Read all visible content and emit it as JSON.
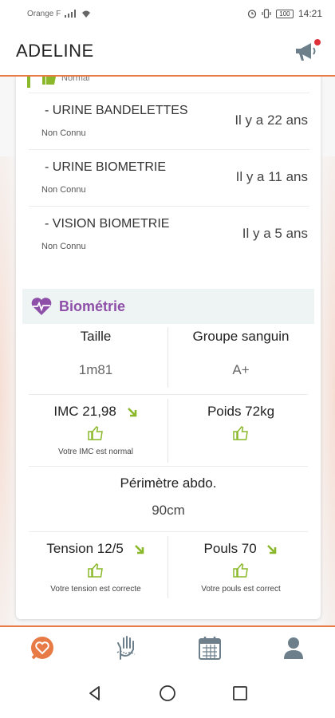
{
  "status_bar": {
    "carrier": "Orange F",
    "time": "14:21",
    "battery": "100"
  },
  "header": {
    "title": "ADELINE"
  },
  "partial_item": {
    "status": "Normal"
  },
  "exams": [
    {
      "name": "- URINE BANDELETTES",
      "status": "Non Connu",
      "when": "Il y a 22 ans"
    },
    {
      "name": "- URINE BIOMETRIE",
      "status": "Non Connu",
      "when": "Il y a 11 ans"
    },
    {
      "name": "- VISION BIOMETRIE",
      "status": "Non Connu",
      "when": "Il y a 5 ans"
    }
  ],
  "biometrie": {
    "title": "Biométrie",
    "taille_label": "Taille",
    "taille_value": "1m81",
    "groupe_label": "Groupe sanguin",
    "groupe_value": "A+",
    "imc_label": "IMC 21,98",
    "imc_note": "Votre IMC est normal",
    "poids_label": "Poids 72kg",
    "perimetre_label": "Périmètre abdo.",
    "perimetre_value": "90cm",
    "tension_label": "Tension 12/5",
    "tension_note": "Votre tension est correcte",
    "pouls_label": "Pouls 70",
    "pouls_note": "Votre pouls est correct"
  },
  "colors": {
    "accent": "#e87a45",
    "ok_green": "#8ab82a",
    "biometrie_purple": "#8e4fa8",
    "nav_gray": "#6c7f8a"
  },
  "bottom_nav": [
    "heart-home-icon",
    "hand-icon",
    "calendar-icon",
    "profile-icon"
  ]
}
